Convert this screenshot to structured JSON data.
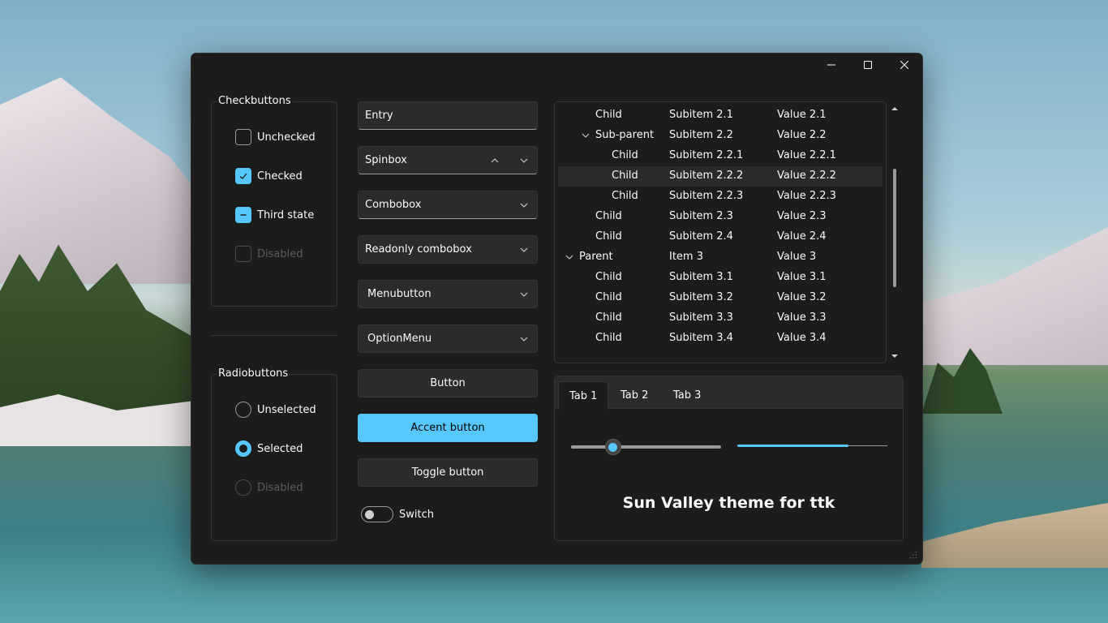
{
  "window": {
    "controls": {
      "minimize_icon": "minimize-icon",
      "maximize_icon": "maximize-icon",
      "close_icon": "close-icon"
    }
  },
  "checkbuttons": {
    "title": "Checkbuttons",
    "items": [
      {
        "label": "Unchecked",
        "state": "unchecked"
      },
      {
        "label": "Checked",
        "state": "checked"
      },
      {
        "label": "Third state",
        "state": "indeterminate"
      },
      {
        "label": "Disabled",
        "state": "disabled"
      }
    ]
  },
  "radiobuttons": {
    "title": "Radiobuttons",
    "items": [
      {
        "label": "Unselected",
        "state": "unselected"
      },
      {
        "label": "Selected",
        "state": "selected"
      },
      {
        "label": "Disabled",
        "state": "disabled"
      }
    ]
  },
  "widgets": {
    "entry_value": "Entry",
    "spinbox_value": "Spinbox",
    "combobox_value": "Combobox",
    "readonly_combobox_value": "Readonly combobox",
    "menubutton_label": "Menubutton",
    "optionmenu_value": "OptionMenu",
    "button_label": "Button",
    "accent_button_label": "Accent button",
    "toggle_button_label": "Toggle button",
    "switch_label": "Switch"
  },
  "tree": {
    "rows": [
      {
        "col0": "Child",
        "col1": "Subitem 2.1",
        "col2": "Value 2.1",
        "selected": false
      },
      {
        "col0": "Sub-parent",
        "col1": "Subitem 2.2",
        "col2": "Value 2.2",
        "expanded": true
      },
      {
        "col0": "Child",
        "col1": "Subitem 2.2.1",
        "col2": "Value 2.2.1"
      },
      {
        "col0": "Child",
        "col1": "Subitem 2.2.2",
        "col2": "Value 2.2.2",
        "selected": true
      },
      {
        "col0": "Child",
        "col1": "Subitem 2.2.3",
        "col2": "Value 2.2.3"
      },
      {
        "col0": "Child",
        "col1": "Subitem 2.3",
        "col2": "Value 2.3"
      },
      {
        "col0": "Child",
        "col1": "Subitem 2.4",
        "col2": "Value 2.4"
      },
      {
        "col0": "Parent",
        "col1": "Item 3",
        "col2": "Value 3",
        "expanded": true
      },
      {
        "col0": "Child",
        "col1": "Subitem 3.1",
        "col2": "Value 3.1"
      },
      {
        "col0": "Child",
        "col1": "Subitem 3.2",
        "col2": "Value 3.2"
      },
      {
        "col0": "Child",
        "col1": "Subitem 3.3",
        "col2": "Value 3.3"
      },
      {
        "col0": "Child",
        "col1": "Subitem 3.4",
        "col2": "Value 3.4"
      }
    ]
  },
  "notebook": {
    "tabs": [
      "Tab 1",
      "Tab 2",
      "Tab 3"
    ],
    "selected_tab": "Tab 1",
    "slider_value_fraction": 0.28,
    "progress_fraction": 0.74,
    "heading": "Sun Valley theme for ttk"
  },
  "colors": {
    "accent": "#57c8ff",
    "window_bg": "#1c1c1c",
    "control_bg": "#2b2b2b",
    "text": "#fafafa",
    "disabled_text": "#5d5d5d"
  }
}
